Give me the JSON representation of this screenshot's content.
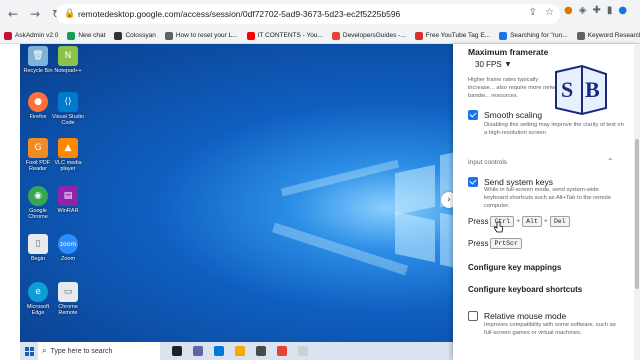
{
  "browser": {
    "url": "remotedesktop.google.com/access/session/0df72702-5ad9-3673-5d23-ec2f5225b596",
    "bookmarks": [
      {
        "label": "AskAdmin v2.0",
        "color": "#c8102e"
      },
      {
        "label": "New chat",
        "color": "#0f9d58"
      },
      {
        "label": "Colossyan",
        "color": "#333333"
      },
      {
        "label": "How to reset your L...",
        "color": "#5f6368"
      },
      {
        "label": "IT CONTENTS - You...",
        "color": "#ff0000"
      },
      {
        "label": "DevelopersGuides -...",
        "color": "#ea4335"
      },
      {
        "label": "Free YouTube Tag E...",
        "color": "#d93025"
      },
      {
        "label": "Searching for \"run...",
        "color": "#1a73e8"
      },
      {
        "label": "Keyword Research...",
        "color": "#5f6368"
      }
    ]
  },
  "desktop": {
    "icons": [
      {
        "label": "Recycle Bin",
        "color": "#7fb2d9",
        "glyph": "🗑"
      },
      {
        "label": "Notepad++",
        "color": "#8bc34a",
        "glyph": "N"
      },
      {
        "label": "Firefox",
        "color": "#ff7139",
        "glyph": "●"
      },
      {
        "label": "Visual Studio Code",
        "color": "#007acc",
        "glyph": "⟨⟩"
      },
      {
        "label": "Foxit PDF Reader",
        "color": "#f08a24",
        "glyph": "G"
      },
      {
        "label": "VLC media player",
        "color": "#ff8800",
        "glyph": "▲"
      },
      {
        "label": "Google Chrome",
        "color": "#34a853",
        "glyph": "◉"
      },
      {
        "label": "WinRAR",
        "color": "#8e24aa",
        "glyph": "▤"
      },
      {
        "label": "Begin",
        "color": "#e8eaed",
        "glyph": "▯"
      },
      {
        "label": "Zoom",
        "color": "#2d8cff",
        "glyph": "zoom"
      },
      {
        "label": "Microsoft Edge",
        "color": "#0c9ed9",
        "glyph": "e"
      },
      {
        "label": "Chrome Remote",
        "color": "#e8eaed",
        "glyph": "▭"
      }
    ],
    "taskbar": {
      "search_placeholder": "Type here to search",
      "apps": [
        "#202124",
        "#6264a7",
        "#0078d4",
        "#f2a900",
        "#4a4a4a",
        "#ea4335",
        "#d0d0d0"
      ]
    },
    "expander_glyph": "›"
  },
  "panel": {
    "max_framerate": {
      "title": "Maximum framerate",
      "value": "30 FPS",
      "desc": "Higher frame rates typically increase... also require more network bandw... resources."
    },
    "smooth_scaling": {
      "title": "Smooth scaling",
      "desc": "Disabling this setting may improve the clarity of text on a high-resolution screen",
      "checked": true
    },
    "input_controls": {
      "label": "Input controls"
    },
    "send_system_keys": {
      "title": "Send system keys",
      "desc": "While in full-screen mode, send system-wide keyboard shortcuts such as Alt+Tab to the remote computer.",
      "checked": true
    },
    "press_label": "Press",
    "combo1": {
      "k1": "Ctrl",
      "k2": "Alt",
      "k3": "Del",
      "plus": "+"
    },
    "combo2": {
      "k1": "PrtScr"
    },
    "configure_key_mappings": "Configure key mappings",
    "configure_keyboard_shortcuts": "Configure keyboard shortcuts",
    "relative_mouse": {
      "title": "Relative mouse mode",
      "desc": "Improves compatibility with some software, such as full-screen games or virtual machines.",
      "checked": false
    }
  }
}
